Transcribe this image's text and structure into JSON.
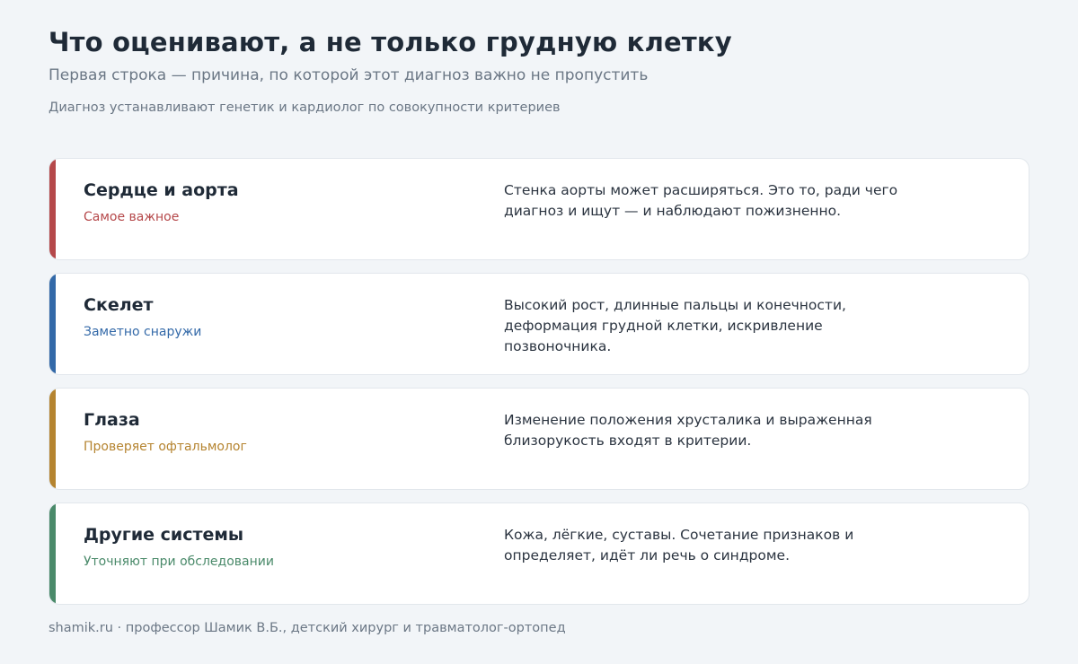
{
  "header": {
    "title": "Что оценивают, а не только грудную клетку",
    "subtitle": "Первая строка — причина, по которой этот диагноз важно не пропустить",
    "note": "Диагноз устанавливают генетик и кардиолог по совокупности критериев"
  },
  "cards": [
    {
      "name": "Сердце и аорта",
      "tag": "Самое важное",
      "description": "Стенка аорты может расширяться. Это то, ради чего диагноз и ищут — и наблюдают пожизненно.",
      "color": "#b5484a"
    },
    {
      "name": "Скелет",
      "tag": "Заметно снаружи",
      "description": "Высокий рост, длинные пальцы и конечности, деформация грудной клетки, искривление позвоночника.",
      "color": "#3369a8"
    },
    {
      "name": "Глаза",
      "tag": "Проверяет офтальмолог",
      "description": "Изменение положения хрусталика и выраженная близорукость входят в критерии.",
      "color": "#b58430"
    },
    {
      "name": "Другие системы",
      "tag": "Уточняют при обследовании",
      "description": "Кожа, лёгкие, суставы. Сочетание признаков и определяет, идёт ли речь о синдроме.",
      "color": "#4a8a6a"
    }
  ],
  "footer": {
    "text": "shamik.ru · профессор Шамик В.Б., детский хирург и травматолог-ортопед"
  }
}
